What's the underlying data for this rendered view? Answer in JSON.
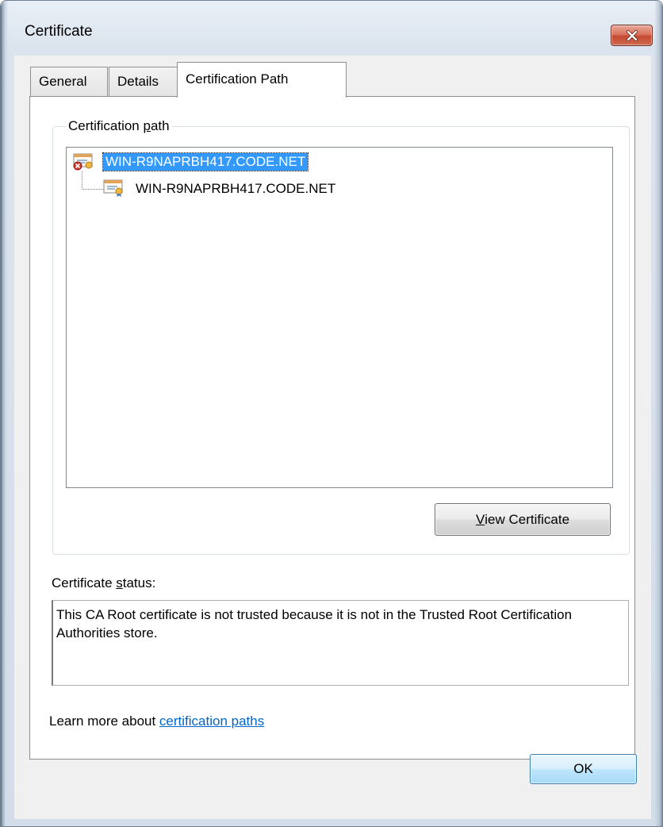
{
  "window": {
    "title": "Certificate"
  },
  "tabs": [
    {
      "label": "General",
      "active": false
    },
    {
      "label": "Details",
      "active": false
    },
    {
      "label": "Certification Path",
      "active": true
    }
  ],
  "cert_path": {
    "group_label_pre": "Certification ",
    "group_label_accel": "p",
    "group_label_post": "ath",
    "nodes": [
      {
        "label": "WIN-R9NAPRBH417.CODE.NET",
        "selected": true,
        "icon": "certificate-error-icon"
      },
      {
        "label": "WIN-R9NAPRBH417.CODE.NET",
        "selected": false,
        "icon": "certificate-icon"
      }
    ],
    "view_button_accel": "V",
    "view_button_rest": "iew Certificate"
  },
  "status": {
    "label_pre": "Certificate ",
    "label_accel": "s",
    "label_post": "tatus:",
    "text": "This CA Root certificate is not trusted because it is not in the Trusted Root Certification Authorities store."
  },
  "learn_more": {
    "prefix": "Learn more about ",
    "link": "certification paths"
  },
  "ok_button": "OK",
  "colors": {
    "selection": "#3399ff",
    "link": "#0066cc",
    "close_button": "#c44a32"
  }
}
